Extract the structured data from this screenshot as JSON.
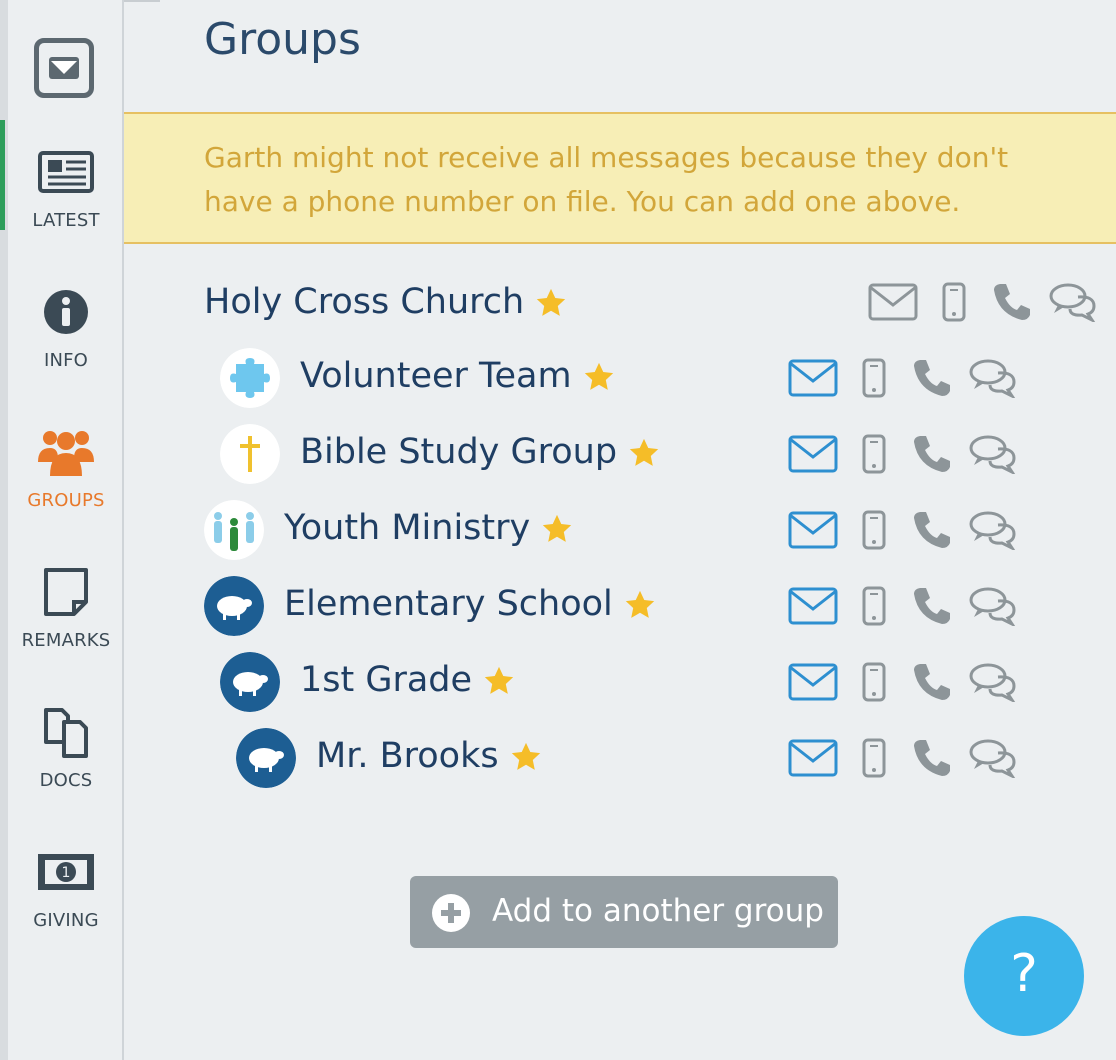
{
  "page": {
    "title": "Groups"
  },
  "sidebar": {
    "items": [
      {
        "label": "LATEST",
        "icon": "newspaper-icon"
      },
      {
        "label": "INFO",
        "icon": "info-icon"
      },
      {
        "label": "GROUPS",
        "icon": "people-icon",
        "active": true
      },
      {
        "label": "REMARKS",
        "icon": "note-icon"
      },
      {
        "label": "DOCS",
        "icon": "documents-icon"
      },
      {
        "label": "GIVING",
        "icon": "money-icon"
      }
    ]
  },
  "alert": {
    "message": "Garth might not receive all messages because they don't have a phone number on file. You can add one above."
  },
  "groups": [
    {
      "name": "Holy Cross Church",
      "avatar": "none"
    },
    {
      "name": "Volunteer Team",
      "avatar": "puzzle-icon"
    },
    {
      "name": "Bible Study Group",
      "avatar": "cross-icon"
    },
    {
      "name": "Youth Ministry",
      "avatar": "people-figures-icon"
    },
    {
      "name": "Elementary School",
      "avatar": "sheep-icon"
    },
    {
      "name": "1st Grade",
      "avatar": "sheep-icon"
    },
    {
      "name": "Mr. Brooks",
      "avatar": "sheep-icon"
    }
  ],
  "add_button": {
    "label": "Add to another group"
  },
  "help_button": {
    "label": "?"
  },
  "colors": {
    "accent_orange": "#e8792b",
    "email_active_blue": "#2d8fd0",
    "icon_gray": "#8d9599",
    "star_gold": "#f5bd28",
    "alert_text": "#d2a63a",
    "alert_bg": "#f7eeb6",
    "help_blue": "#3bb4ea"
  }
}
